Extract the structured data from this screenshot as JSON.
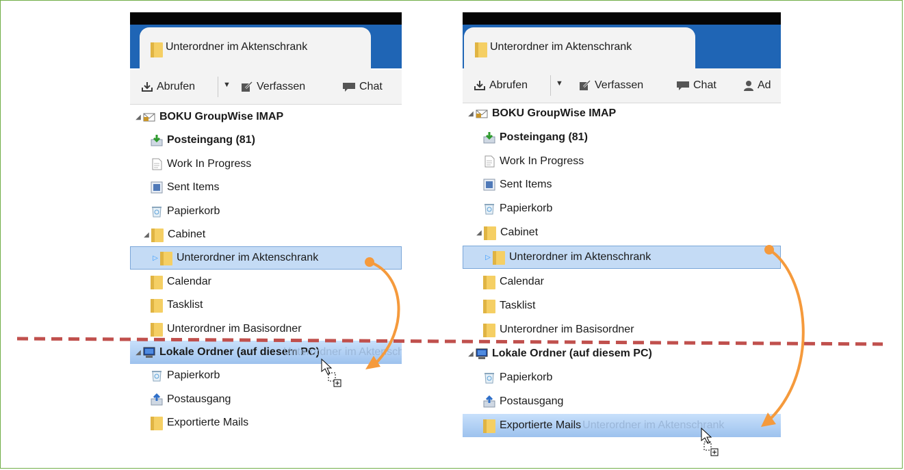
{
  "colors": {
    "tab_strip": "#1f65b5",
    "selection": "#c4dbf5",
    "drop_target": "#9dc2ee",
    "dashed_line": "#c0504d",
    "arrow": "#f59a3c",
    "frame": "#70ad47"
  },
  "left": {
    "tab_title": "Unterordner im Aktenschrank",
    "toolbar": {
      "get": "Abrufen",
      "compose": "Verfassen",
      "chat": "Chat"
    },
    "account": "BOKU GroupWise IMAP",
    "inbox": "Posteingang (81)",
    "work": "Work In Progress",
    "sent": "Sent Items",
    "trash": "Papierkorb",
    "cabinet": "Cabinet",
    "subfolder": "Unterordner im Aktenschrank",
    "calendar": "Calendar",
    "tasklist": "Tasklist",
    "basis": "Unterordner im Basisordner",
    "local": "Lokale Ordner (auf diesem PC)",
    "ghost": "Unterordner im Aktenschrank",
    "local_trash": "Papierkorb",
    "outbox": "Postausgang",
    "exported": "Exportierte Mails"
  },
  "right": {
    "tab_title": "Unterordner im Aktenschrank",
    "toolbar": {
      "get": "Abrufen",
      "compose": "Verfassen",
      "chat": "Chat",
      "address": "Ad"
    },
    "account": "BOKU GroupWise IMAP",
    "inbox": "Posteingang (81)",
    "work": "Work In Progress",
    "sent": "Sent Items",
    "trash": "Papierkorb",
    "cabinet": "Cabinet",
    "subfolder": "Unterordner im Aktenschrank",
    "calendar": "Calendar",
    "tasklist": "Tasklist",
    "basis": "Unterordner im Basisordner",
    "local": "Lokale Ordner (auf diesem PC)",
    "local_trash": "Papierkorb",
    "outbox": "Postausgang",
    "exported": "Exportierte Mails",
    "ghost": "Unterordner im Aktenschrank"
  },
  "icons": {
    "folder": "folder-icon",
    "account": "mail-account-icon",
    "inbox": "inbox-icon",
    "drafts": "document-icon",
    "sent": "sent-icon",
    "trash": "trash-icon",
    "local": "computer-icon",
    "outbox": "outbox-icon",
    "cursor": "drag-copy-cursor-icon"
  }
}
